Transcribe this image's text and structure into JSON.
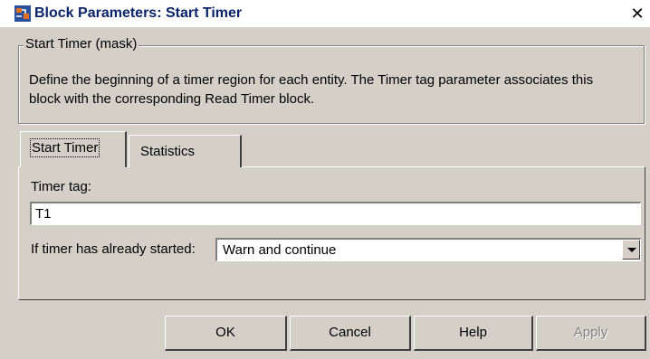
{
  "window": {
    "title": "Block Parameters: Start Timer",
    "close_label": "✕",
    "title_icon": "simulink-block-icon"
  },
  "mask": {
    "group_title": "Start Timer (mask)",
    "description": "Define the beginning of a timer region for each entity. The Timer tag parameter associates this block with the corresponding Read Timer block."
  },
  "tabs": [
    {
      "label": "Start Timer",
      "active": true
    },
    {
      "label": "Statistics",
      "active": false
    }
  ],
  "params": {
    "timer_tag_label": "Timer tag:",
    "timer_tag_value": "T1",
    "started_label": "If timer has already started:",
    "started_value": "Warn and continue"
  },
  "buttons": {
    "ok": "OK",
    "cancel": "Cancel",
    "help": "Help",
    "apply": "Apply"
  }
}
